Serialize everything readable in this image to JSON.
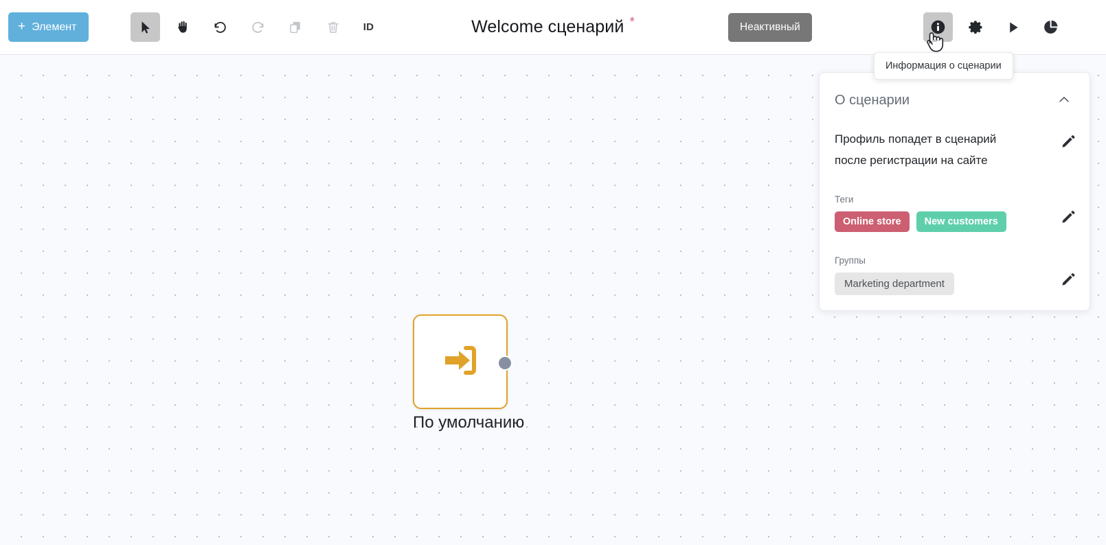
{
  "toolbar": {
    "add_element_label": "Элемент",
    "add_element_plus": "+",
    "tools": [
      {
        "name": "select-tool",
        "icon": "cursor-arrow-icon",
        "state": "active"
      },
      {
        "name": "pan-tool",
        "icon": "hand-icon",
        "state": "enabled"
      },
      {
        "name": "undo-tool",
        "icon": "undo-arrow-icon",
        "state": "enabled"
      },
      {
        "name": "redo-tool",
        "icon": "redo-arrow-icon",
        "state": "disabled"
      },
      {
        "name": "copy-tool",
        "icon": "copy-icon",
        "state": "disabled"
      },
      {
        "name": "delete-tool",
        "icon": "trash-icon",
        "state": "disabled"
      },
      {
        "name": "id-tool",
        "icon": "id-text-icon",
        "state": "enabled"
      }
    ],
    "id_label": "ID",
    "right_tools": [
      {
        "name": "scenario-info",
        "icon": "info-circle-icon",
        "state": "active"
      },
      {
        "name": "scenario-settings",
        "icon": "gear-icon",
        "state": "enabled"
      },
      {
        "name": "scenario-run",
        "icon": "play-triangle-icon",
        "state": "enabled"
      },
      {
        "name": "scenario-stats",
        "icon": "pie-chart-icon",
        "state": "enabled"
      }
    ]
  },
  "header": {
    "title": "Welcome сценарий",
    "unsaved_marker": "*",
    "status_label": "Неактивный",
    "status_color": "#777777"
  },
  "tooltip": {
    "text": "Информация о сценарии"
  },
  "info_panel": {
    "title": "О сценарии",
    "collapse_icon": "chevron-up-icon",
    "description": "Профиль попадет в сценарий после регистрации на сайте",
    "description_edit_icon": "pencil-icon",
    "tags_label": "Теги",
    "tags": [
      {
        "label": "Online store",
        "color": "#cc5f71"
      },
      {
        "label": "New customers",
        "color": "#5fcfab"
      }
    ],
    "tags_edit_icon": "pencil-icon",
    "groups_label": "Группы",
    "groups": [
      {
        "label": "Marketing department",
        "color": "#e6e6e6"
      }
    ],
    "groups_edit_icon": "pencil-icon"
  },
  "canvas": {
    "nodes": [
      {
        "label": "По умолчанию",
        "icon": "entry-point-icon",
        "border_color": "#e0a229",
        "port_color": "#8790a3"
      }
    ]
  },
  "colors": {
    "accent_blue": "#61b0dc",
    "node_orange": "#e0a229",
    "canvas_bg": "#f8fafd",
    "required_star": "#cf647a"
  }
}
